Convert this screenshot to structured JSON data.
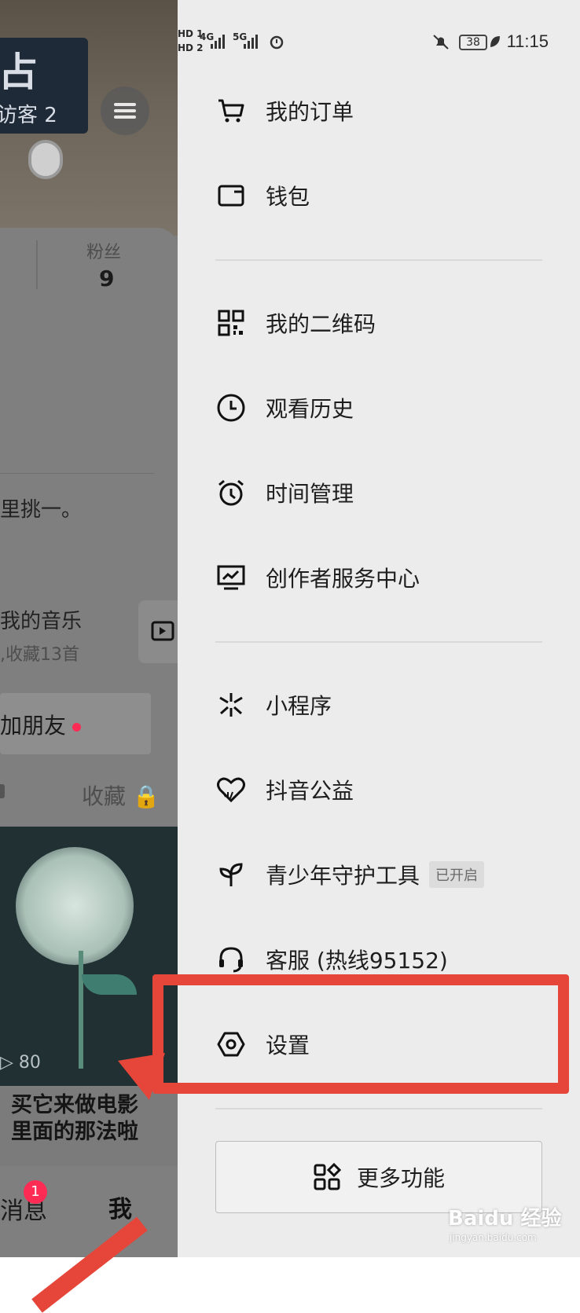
{
  "status_bar": {
    "sim1": "HD 1",
    "sim2": "HD 2",
    "net1": "4G",
    "net2": "5G",
    "battery": "38",
    "time": "11:15"
  },
  "profile_background": {
    "sign_big": "占",
    "sign_small": "访客 2",
    "fans_label": "粉丝",
    "fans_count": "9",
    "bio": "里挑一。",
    "music_title": "我的音乐",
    "music_sub": ",收藏13首",
    "add_friend": "加朋友",
    "collect_tab": "收藏",
    "video_views": "80",
    "thumb_text_line1": "买它来做电影",
    "thumb_text_line2": "里面的那法啦",
    "nav_message": "消息",
    "nav_me": "我",
    "message_badge": "1"
  },
  "drawer": {
    "items": [
      {
        "label": "我的订单",
        "icon": "cart-icon"
      },
      {
        "label": "钱包",
        "icon": "wallet-icon"
      },
      {
        "label": "我的二维码",
        "icon": "qrcode-icon"
      },
      {
        "label": "观看历史",
        "icon": "clock-icon"
      },
      {
        "label": "时间管理",
        "icon": "alarm-icon"
      },
      {
        "label": "创作者服务中心",
        "icon": "monitor-chart-icon"
      },
      {
        "label": "小程序",
        "icon": "mini-program-icon"
      },
      {
        "label": "抖音公益",
        "icon": "charity-heart-icon"
      },
      {
        "label": "青少年守护工具",
        "icon": "sprout-icon",
        "tag": "已开启"
      },
      {
        "label": "客服 (热线95152)",
        "icon": "headset-icon"
      },
      {
        "label": "设置",
        "icon": "settings-hexagon-icon"
      }
    ],
    "more_button": "更多功能"
  },
  "watermark": {
    "brand": "Baidu 经验",
    "url": "jingyan.baidu.com"
  },
  "colors": {
    "drawer_bg": "#ececec",
    "highlight": "#e6463a",
    "accent_red": "#fe2c55"
  }
}
